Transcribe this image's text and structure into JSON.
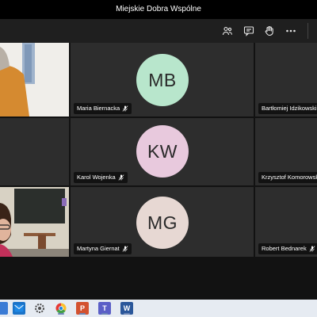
{
  "window": {
    "title": "Miejskie Dobra Wspólne"
  },
  "toolbar": {
    "icons": [
      "people-icon",
      "chat-icon",
      "raise-hand-icon",
      "more-icon"
    ]
  },
  "participants": [
    {
      "name": "Maria Biernacka",
      "initials": "MB",
      "avatar_color": "#b8e6cc"
    },
    {
      "name": "Bartłomiej Idzikowski"
    },
    {
      "name": "Karol Wojenka",
      "initials": "KW",
      "avatar_color": "#e8c9dd"
    },
    {
      "name": "Krzysztof Komorowski"
    },
    {
      "name": "Martyna Giernat",
      "initials": "MG",
      "avatar_color": "#e7d8d3"
    },
    {
      "name": "Robert Bednarek"
    }
  ],
  "taskbar": {
    "apps": [
      "mail-app",
      "settings-app",
      "chrome-app",
      "powerpoint-app",
      "teams-app",
      "word-app"
    ]
  }
}
